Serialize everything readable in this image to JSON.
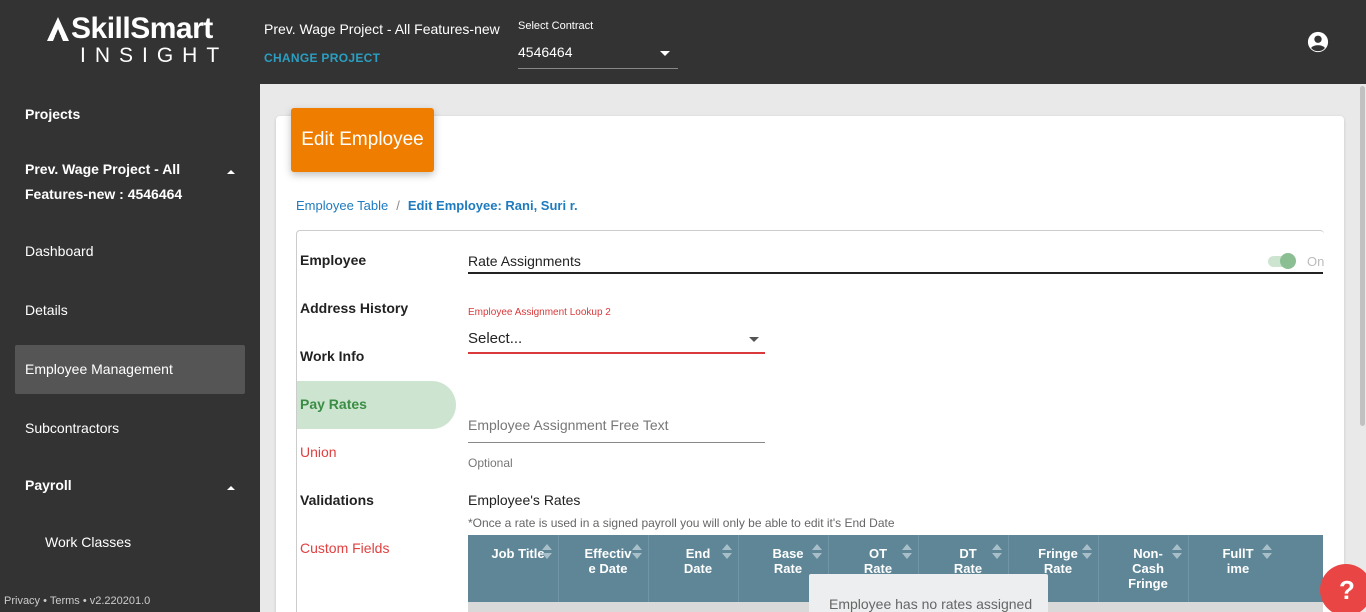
{
  "header": {
    "logo_main": "SkillSmart",
    "logo_sub": "INSIGHT",
    "project_name": "Prev. Wage Project - All Features-new",
    "change_project": "CHANGE PROJECT",
    "contract_label": "Select Contract",
    "contract_value": "4546464",
    "account_icon": "account-circle-icon"
  },
  "sidebar": {
    "projects": "Projects",
    "project_line1": "Prev. Wage Project - All",
    "project_line2": "Features-new : 4546464",
    "dashboard": "Dashboard",
    "details": "Details",
    "employee_management": "Employee Management",
    "subcontractors": "Subcontractors",
    "payroll": "Payroll",
    "work_classes": "Work Classes",
    "footer": "Privacy • Terms • v2.220201.0"
  },
  "page": {
    "title": "Edit Employee",
    "breadcrumb_root": "Employee Table",
    "breadcrumb_sep": "/",
    "breadcrumb_current": "Edit Employee: Rani, Suri r."
  },
  "tabs": {
    "employee": "Employee",
    "address_history": "Address History",
    "work_info": "Work Info",
    "pay_rates": "Pay Rates",
    "union": "Union",
    "validations": "Validations",
    "custom_fields": "Custom Fields"
  },
  "rate_assignments": {
    "title": "Rate Assignments",
    "toggle_label": "On",
    "lookup_label": "Employee Assignment Lookup 2",
    "lookup_value": "Select...",
    "free_text_placeholder": "Employee Assignment Free Text",
    "free_text_hint": "Optional"
  },
  "rates": {
    "title": "Employee's Rates",
    "note": "*Once a rate is used in a signed payroll you will only be able to edit it's End Date",
    "columns": [
      [
        "Job Title"
      ],
      [
        "Effectiv",
        "e Date"
      ],
      [
        "End",
        "Date"
      ],
      [
        "Base",
        "Rate"
      ],
      [
        "OT",
        "Rate"
      ],
      [
        "DT",
        "Rate"
      ],
      [
        "Fringe",
        "Rate"
      ],
      [
        "Non-",
        "Cash",
        "Fringe"
      ],
      [
        "FullT",
        "ime"
      ]
    ],
    "empty_message": "Employee has no rates assigned"
  },
  "help": "?",
  "colors": {
    "accent_orange": "#ef7d00",
    "link_blue": "#1e7bbf",
    "active_green": "#3b8d45",
    "error_red": "#d9393b",
    "table_header": "#5f8697"
  }
}
